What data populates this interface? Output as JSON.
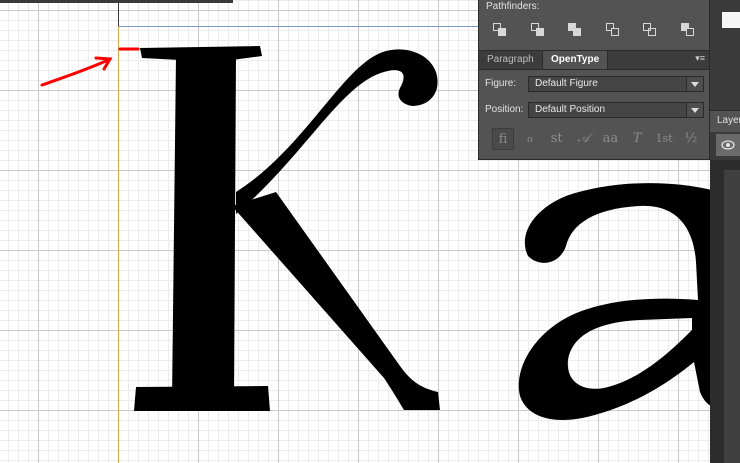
{
  "panel": {
    "pathfinders_label": "Pathfinders:",
    "pathfinder_buttons": [
      "divide-icon",
      "trim-icon",
      "merge-icon",
      "crop-icon",
      "outline-icon",
      "minus-back-icon"
    ],
    "tabs": [
      {
        "label": "Paragraph",
        "active": false
      },
      {
        "label": "OpenType",
        "active": true
      }
    ],
    "figure": {
      "label": "Figure:",
      "value": "Default Figure"
    },
    "position": {
      "label": "Position:",
      "value": "Default Position"
    },
    "opentype_buttons": [
      {
        "glyph": "fi",
        "name": "standard-ligatures-icon"
      },
      {
        "glyph": "ℴ",
        "name": "contextual-alternates-icon"
      },
      {
        "glyph": "st",
        "name": "discretionary-ligatures-icon"
      },
      {
        "glyph": "𝒜",
        "name": "swash-icon"
      },
      {
        "glyph": "aa",
        "name": "stylistic-alternates-icon"
      },
      {
        "glyph": "T",
        "name": "titling-alternates-icon"
      },
      {
        "glyph": "1st",
        "name": "ordinals-icon"
      },
      {
        "glyph": "½",
        "name": "fractions-icon"
      }
    ]
  },
  "layers_panel": {
    "label": "Layers"
  },
  "artwork": {
    "letters": "Ka",
    "annotation_color": "#ff0000"
  },
  "colors": {
    "panel_bg": "#535353",
    "guide_blue": "#7e9cc3",
    "guide_orange": "#d6a54c"
  }
}
